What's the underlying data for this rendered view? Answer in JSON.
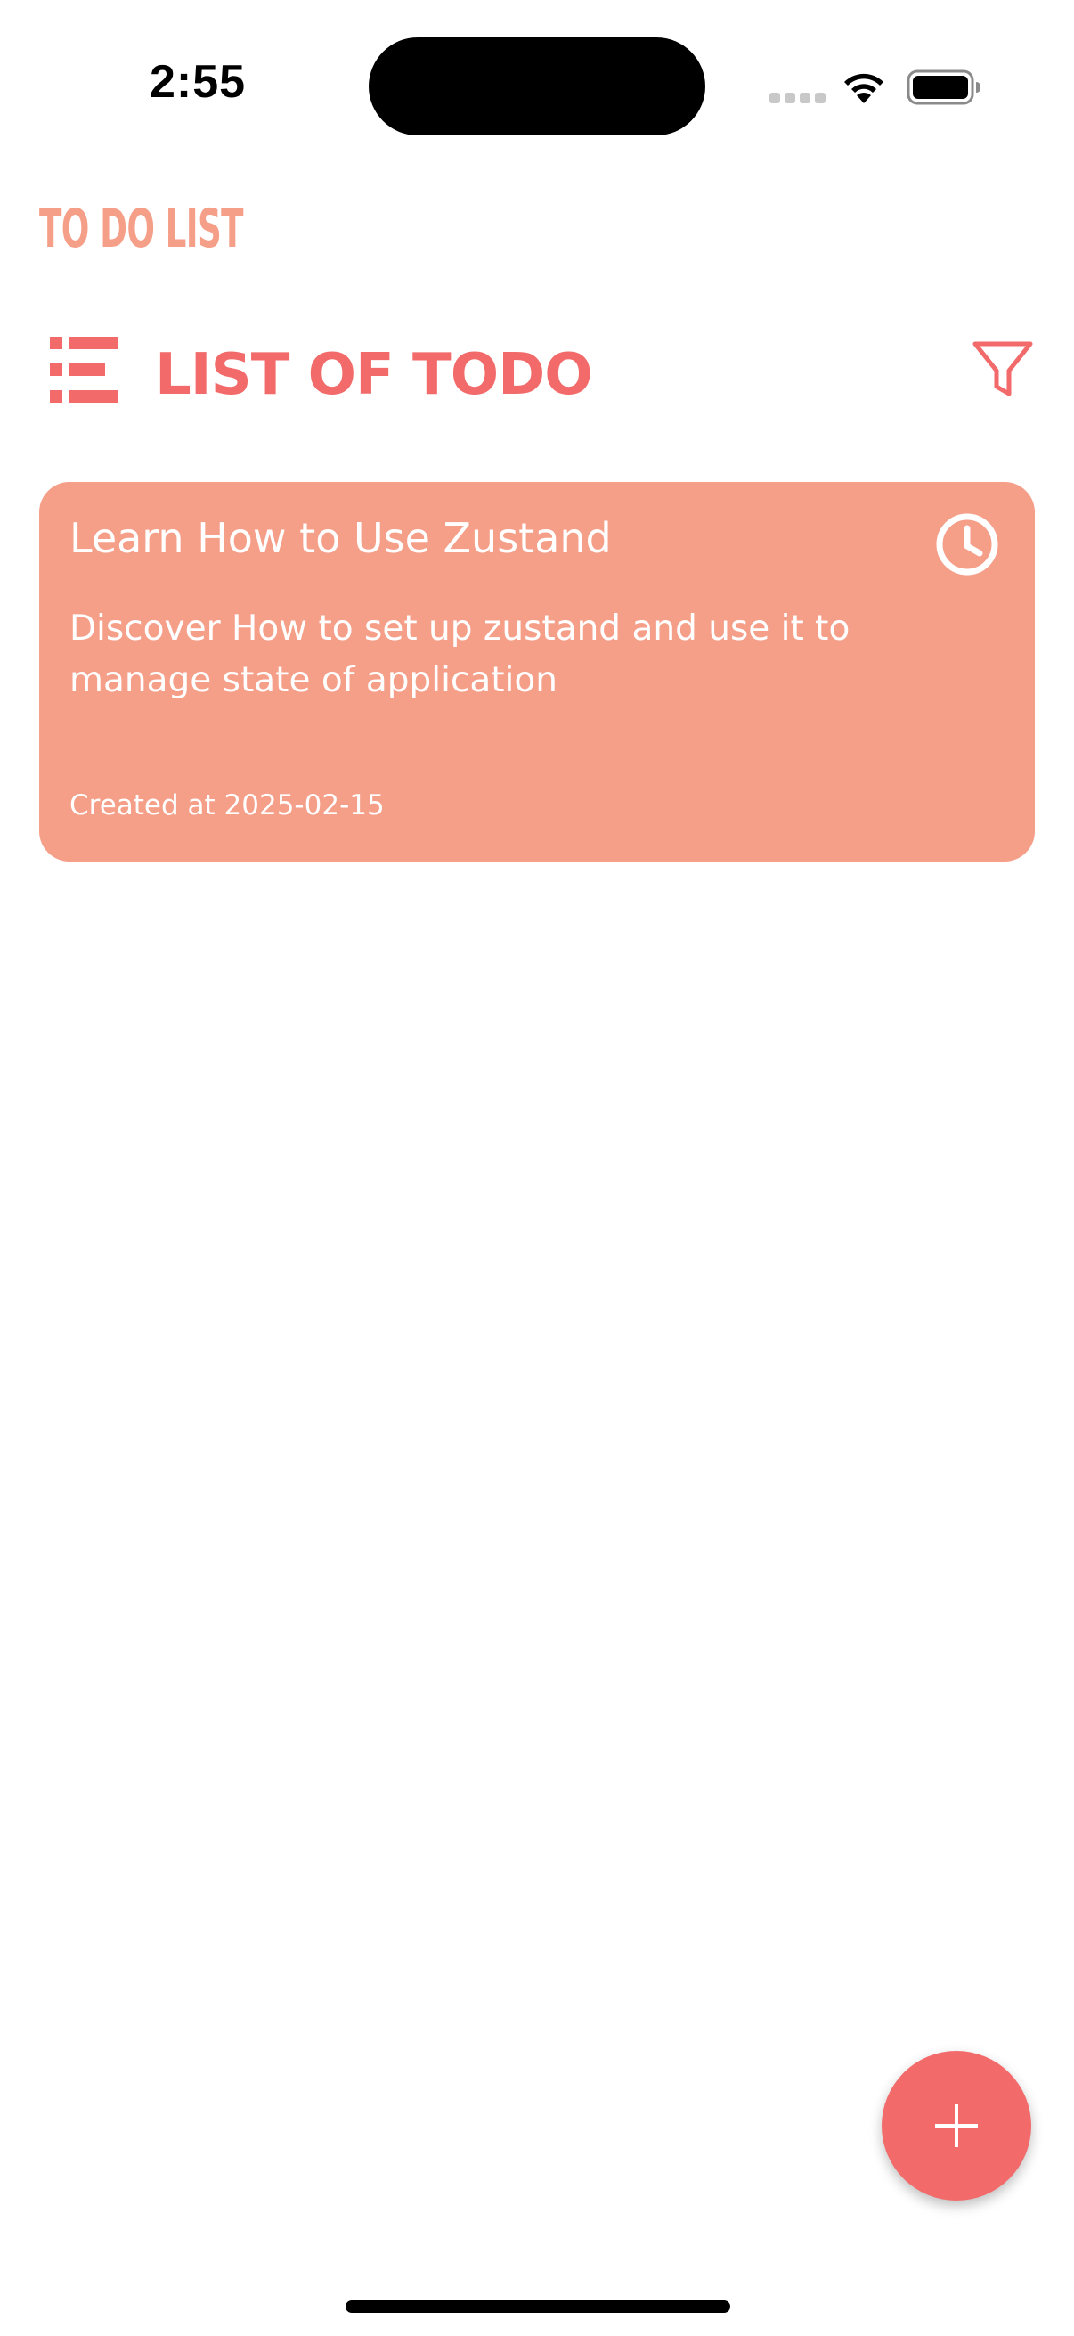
{
  "status_bar": {
    "time": "2:55"
  },
  "app": {
    "title": "TO DO LIST",
    "section_title": "LIST OF TODO",
    "accent_color": "#f26a6a",
    "card_color": "#f59e88",
    "title_color": "#f59e88"
  },
  "todos": [
    {
      "title": "Learn How to Use Zustand",
      "description": "Discover How to set up zustand and use it to manage state of application",
      "created": "Created at 2025-02-15"
    }
  ],
  "icons": {
    "list": "list-icon",
    "filter": "filter-icon",
    "clock": "clock-icon",
    "add": "plus-icon"
  }
}
